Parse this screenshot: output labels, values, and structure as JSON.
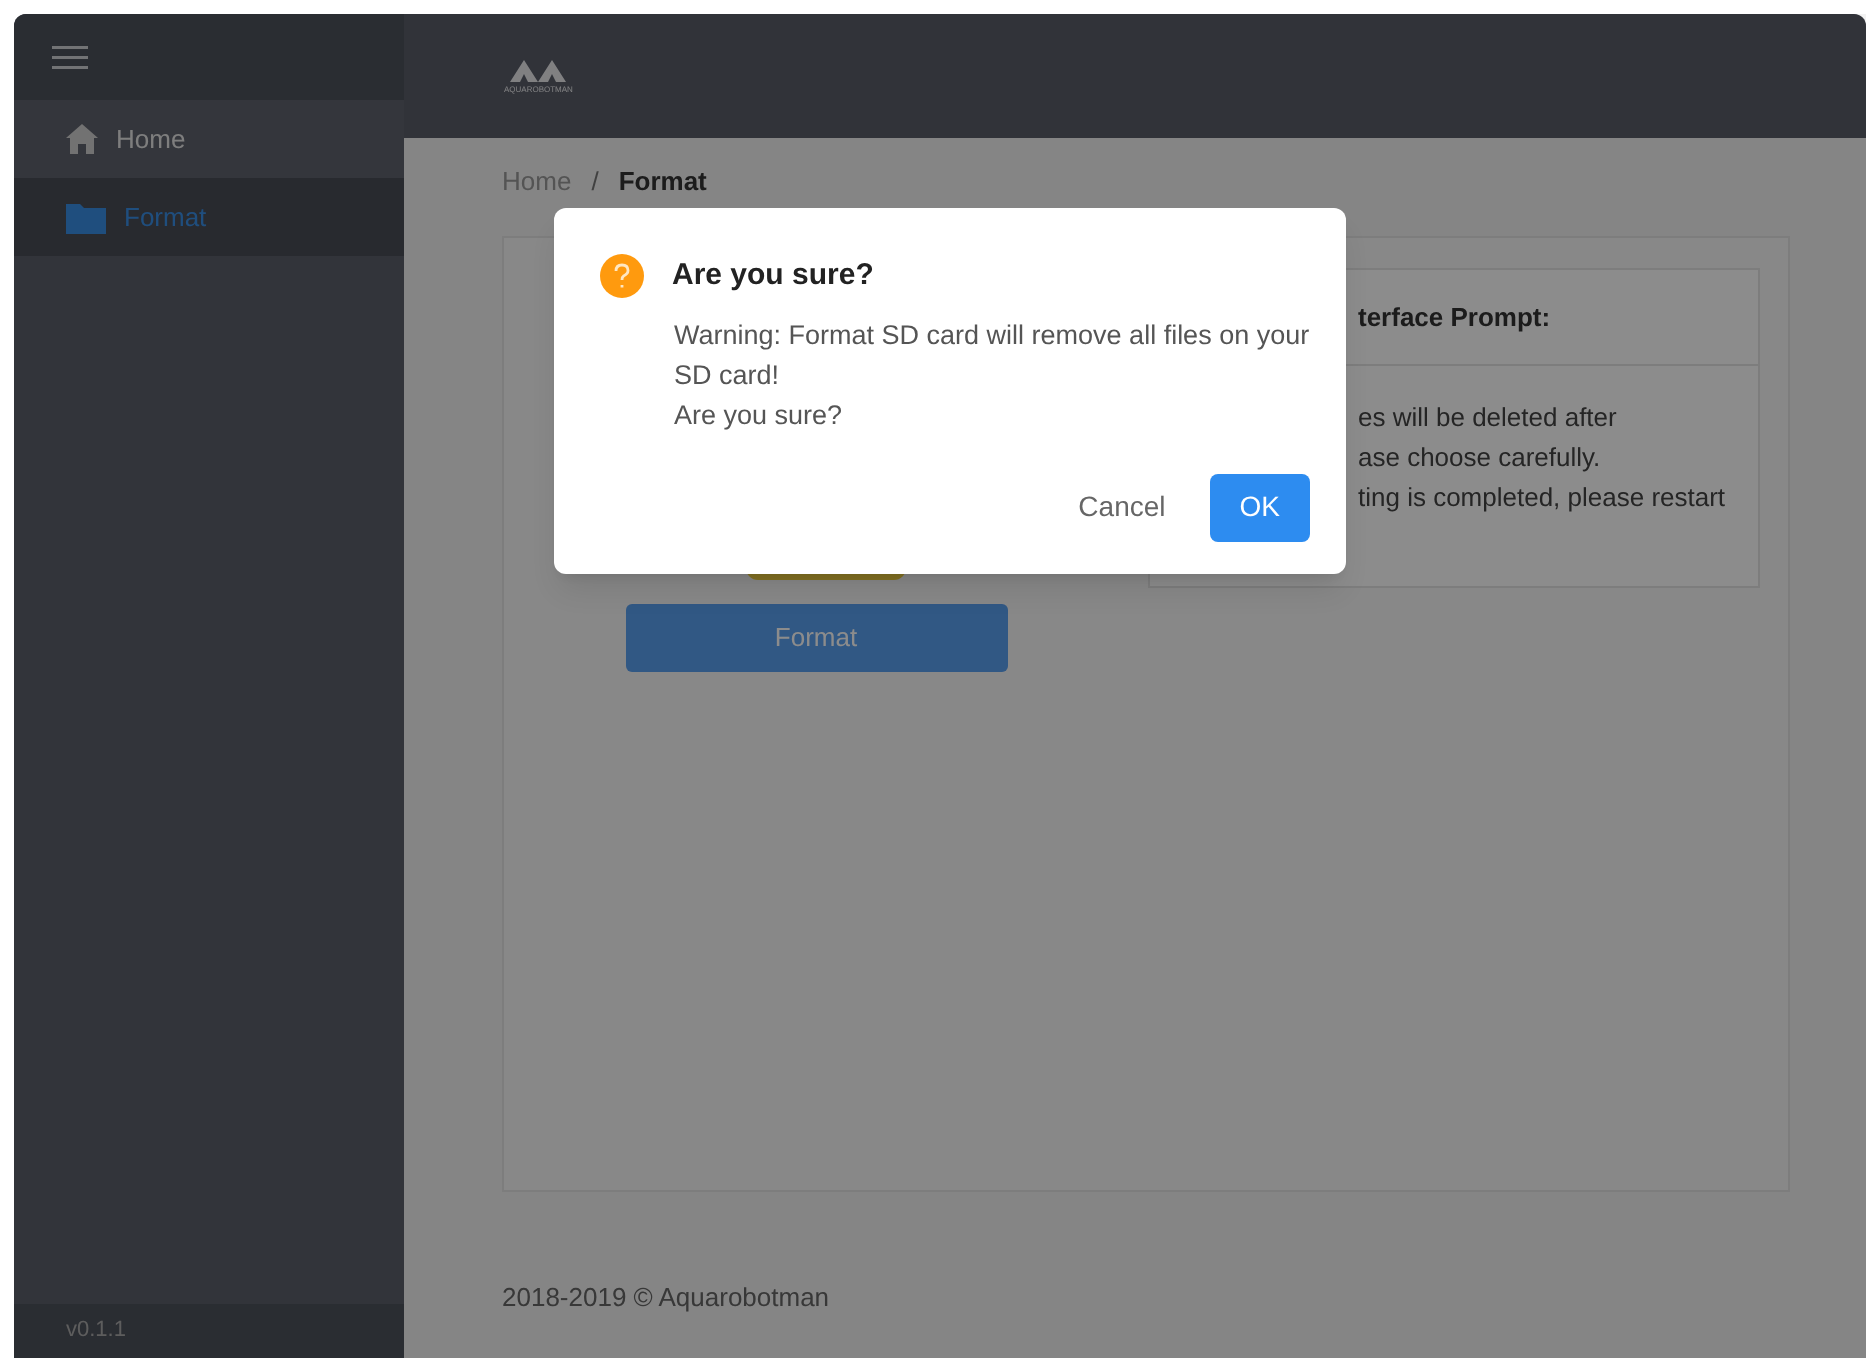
{
  "sidebar": {
    "items": [
      {
        "label": "Home",
        "kind": "home",
        "selected": false
      },
      {
        "label": "Format",
        "kind": "folder",
        "selected": true
      }
    ],
    "version": "v0.1.1"
  },
  "header": {
    "logo_text": "AQUAROBOTMAN"
  },
  "breadcrumb": {
    "separator": "/",
    "items": [
      "Home",
      "Format"
    ]
  },
  "format_button": "Format",
  "prompt_panel": {
    "title": "terface Prompt:",
    "lines": [
      "es will be deleted after",
      "ase choose carefully.",
      "ting is completed, please restart"
    ]
  },
  "footer": "2018-2019 © Aquarobotman",
  "dialog": {
    "title": "Are you sure?",
    "message": "Warning: Format SD card will remove all files on your SD card!",
    "question": "Are you sure?",
    "buttons": [
      {
        "label": "Cancel",
        "kind": "text"
      },
      {
        "label": "OK",
        "kind": "primary"
      }
    ]
  }
}
